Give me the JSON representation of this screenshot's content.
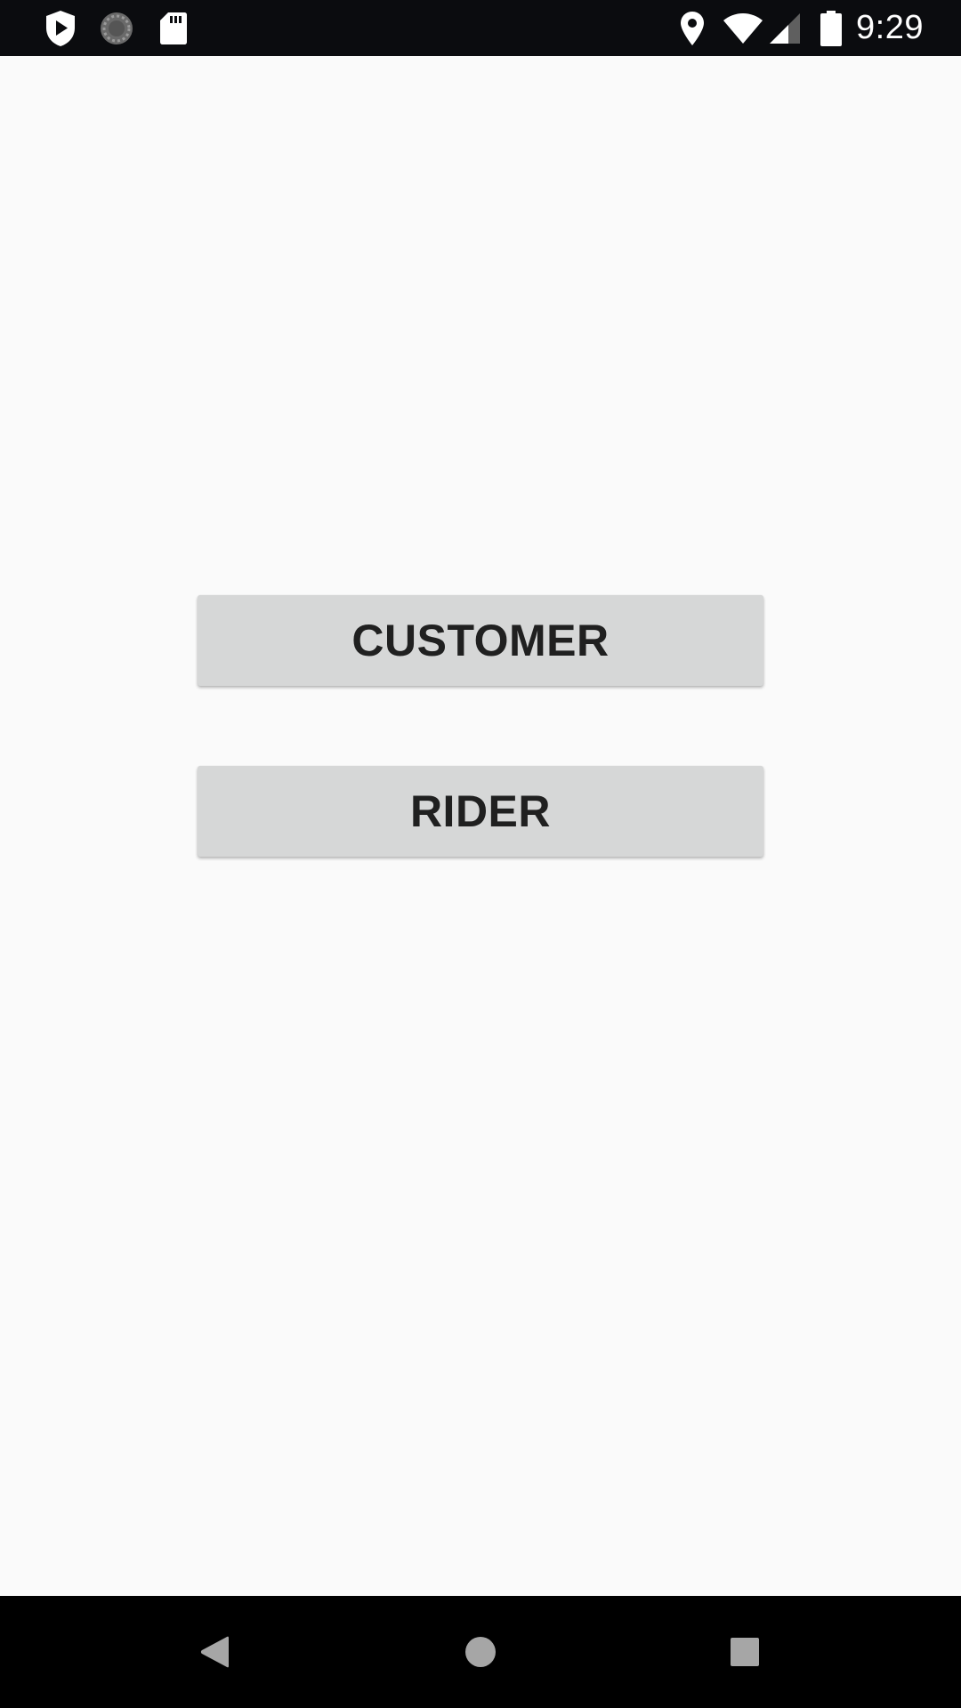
{
  "status_bar": {
    "time": "9:29",
    "icons": [
      "shield-play-icon",
      "sync-progress-icon",
      "sd-card-icon",
      "location-icon",
      "wifi-icon",
      "signal-icon",
      "battery-icon"
    ]
  },
  "main": {
    "customer_button": "CUSTOMER",
    "rider_button": "RIDER"
  },
  "nav_bar": {
    "icons": [
      "back-icon",
      "home-icon",
      "recents-icon"
    ]
  },
  "colors": {
    "background": "#fafafa",
    "button": "#d6d7d7",
    "button_text": "#202020",
    "status_bar": "#0b0c0f",
    "nav_bar": "#000000"
  }
}
